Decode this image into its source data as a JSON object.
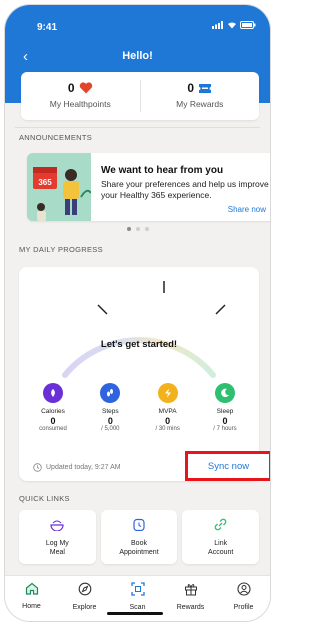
{
  "status_bar": {
    "time": "9:41"
  },
  "header": {
    "title": "Hello!",
    "back_icon": "chevron-left-icon"
  },
  "points": {
    "healthpoints": {
      "value": "0",
      "label": "My Healthpoints",
      "icon": "heart-icon"
    },
    "rewards": {
      "value": "0",
      "label": "My Rewards",
      "icon": "ticket-icon"
    }
  },
  "announcements": {
    "section_title": "ANNOUNCEMENTS",
    "card": {
      "art_badge": "365",
      "headline": "We want to hear from you",
      "body": "Share your preferences and help us improve your Healthy 365 experience.",
      "link": "Share now"
    },
    "carousel": {
      "total": 3,
      "active_index": 0
    }
  },
  "progress": {
    "section_title": "MY DAILY PROGRESS",
    "gauge_text": "Let's get started!",
    "metrics": [
      {
        "label": "Calories",
        "value": "0",
        "unit": "consumed",
        "icon": "flame-icon",
        "color": "#6a2fd6"
      },
      {
        "label": "Steps",
        "value": "0",
        "unit": "/ 5,000",
        "icon": "footsteps-icon",
        "color": "#2f63e0"
      },
      {
        "label": "MVPA",
        "value": "0",
        "unit": "/ 30 mins",
        "icon": "lightning-icon",
        "color": "#f2b21e"
      },
      {
        "label": "Sleep",
        "value": "0",
        "unit": "/ 7 hours",
        "icon": "moon-icon",
        "color": "#2fbf71"
      }
    ],
    "updated_text": "Updated today, 9:27 AM",
    "sync_label": "Sync now"
  },
  "quick_links": {
    "section_title": "QUICK LINKS",
    "items": [
      {
        "label_line1": "Log My",
        "label_line2": "Meal",
        "icon": "meal-icon"
      },
      {
        "label_line1": "Book",
        "label_line2": "Appointment",
        "icon": "clock-icon"
      },
      {
        "label_line1": "Link",
        "label_line2": "Account",
        "icon": "link-icon"
      }
    ]
  },
  "bottom_nav": [
    {
      "label": "Home",
      "icon": "home-icon",
      "active": true
    },
    {
      "label": "Explore",
      "icon": "compass-icon",
      "active": false
    },
    {
      "label": "Scan",
      "icon": "scan-icon",
      "active": false
    },
    {
      "label": "Rewards",
      "icon": "gift-icon",
      "active": false
    },
    {
      "label": "Profile",
      "icon": "profile-icon",
      "active": false
    }
  ],
  "colors": {
    "brand_blue": "#1f78d6",
    "highlight_red": "#e8141c",
    "background": "#f2f1ef"
  }
}
